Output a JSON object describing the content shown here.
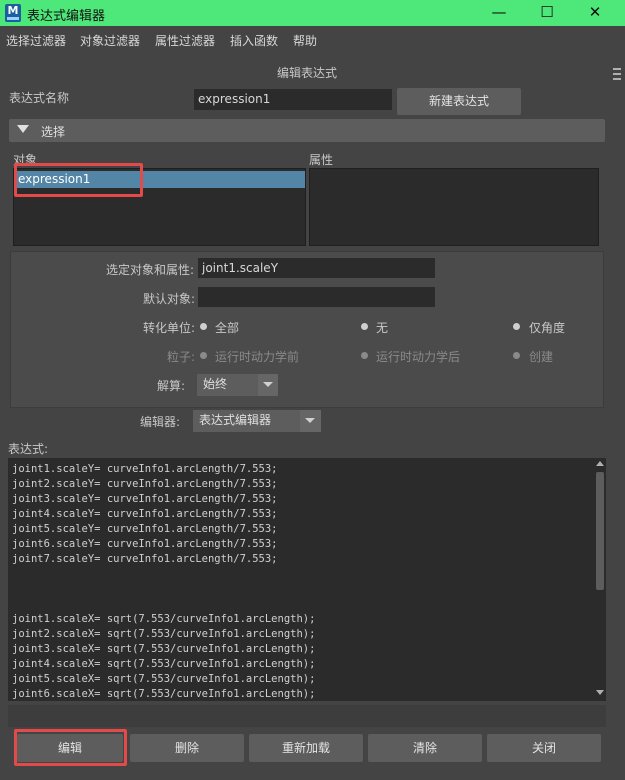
{
  "window": {
    "title": "表达式编辑器",
    "logo_letter": "M",
    "minimize": "—",
    "maximize": "☐",
    "close": "✕"
  },
  "menu": {
    "items": [
      "选择过滤器",
      "对象过滤器",
      "属性过滤器",
      "插入函数",
      "帮助"
    ]
  },
  "header": {
    "title": "编辑表达式"
  },
  "expression_name": {
    "label": "表达式名称",
    "value": "expression1",
    "new_button": "新建表达式"
  },
  "section": {
    "label": "选择"
  },
  "lists": {
    "objects_label": "对象",
    "attributes_label": "属性",
    "objects": [
      "expression1"
    ]
  },
  "attributes": {
    "selected_label": "选定对象和属性:",
    "selected_value": "joint1.scaleY",
    "default_object_label": "默认对象:",
    "default_object_value": "",
    "convert_units_label": "转化单位:",
    "convert_options": [
      "全部",
      "无",
      "仅角度"
    ],
    "particle_label": "粒子:",
    "particle_options": [
      "运行时动力学前",
      "运行时动力学后",
      "创建"
    ],
    "evaluate_label": "解算:",
    "evaluate_value": "始终"
  },
  "editor": {
    "label": "编辑器:",
    "value": "表达式编辑器",
    "expression_label": "表达式:",
    "lines": [
      "joint1.scaleY= curveInfo1.arcLength/7.553;",
      "joint2.scaleY= curveInfo1.arcLength/7.553;",
      "joint3.scaleY= curveInfo1.arcLength/7.553;",
      "joint4.scaleY= curveInfo1.arcLength/7.553;",
      "joint5.scaleY= curveInfo1.arcLength/7.553;",
      "joint6.scaleY= curveInfo1.arcLength/7.553;",
      "joint7.scaleY= curveInfo1.arcLength/7.553;",
      "",
      "",
      "",
      "joint1.scaleX= sqrt(7.553/curveInfo1.arcLength);",
      "joint2.scaleX= sqrt(7.553/curveInfo1.arcLength);",
      "joint3.scaleX= sqrt(7.553/curveInfo1.arcLength);",
      "joint4.scaleX= sqrt(7.553/curveInfo1.arcLength);",
      "joint5.scaleX= sqrt(7.553/curveInfo1.arcLength);",
      "joint6.scaleX= sqrt(7.553/curveInfo1.arcLength);"
    ]
  },
  "buttons": {
    "edit": "编辑",
    "delete": "删除",
    "reload": "重新加载",
    "clear": "清除",
    "close": "关闭"
  },
  "colors": {
    "titlebar": "#4ee87a",
    "selection": "#5285a6",
    "highlight": "#e34a4a"
  }
}
